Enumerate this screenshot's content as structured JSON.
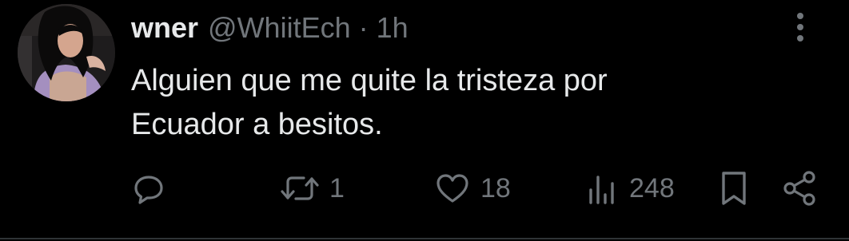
{
  "tweet": {
    "display_name": "wner",
    "handle": "@WhiitEch",
    "separator": "·",
    "time": "1h",
    "text_line1": "Alguien que me quite la tristeza por",
    "text_line2": "Ecuador a besitos."
  },
  "actions": {
    "reply_icon": "reply-icon",
    "retweet_icon": "retweet-icon",
    "retweet_count": "1",
    "like_icon": "heart-icon",
    "like_count": "18",
    "views_icon": "views-icon",
    "views_count": "248",
    "bookmark_icon": "bookmark-icon",
    "share_icon": "share-icon",
    "more_icon": "more-vertical-icon"
  },
  "colors": {
    "background": "#000000",
    "text_primary": "#e7e9ea",
    "text_secondary": "#71767b"
  }
}
